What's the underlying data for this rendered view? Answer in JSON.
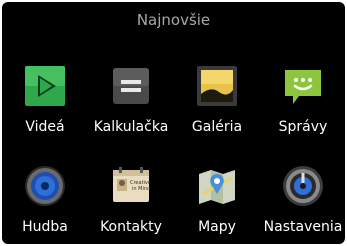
{
  "header": {
    "title": "Najnovšie"
  },
  "apps": [
    {
      "label": "Videá",
      "icon": "video-play-icon"
    },
    {
      "label": "Kalkulačka",
      "icon": "calculator-icon"
    },
    {
      "label": "Galéria",
      "icon": "gallery-icon"
    },
    {
      "label": "Správy",
      "icon": "messages-icon"
    },
    {
      "label": "Hudba",
      "icon": "music-speaker-icon"
    },
    {
      "label": "Kontakty",
      "icon": "contacts-icon",
      "card_text": "Creative in Mind"
    },
    {
      "label": "Mapy",
      "icon": "maps-icon"
    },
    {
      "label": "Nastavenia",
      "icon": "settings-icon"
    }
  ],
  "colors": {
    "background": "#000000",
    "title": "#a8a8a8",
    "video_green": "#2ea84a",
    "messages_green": "#8cc63f",
    "label": "#ffffff"
  }
}
